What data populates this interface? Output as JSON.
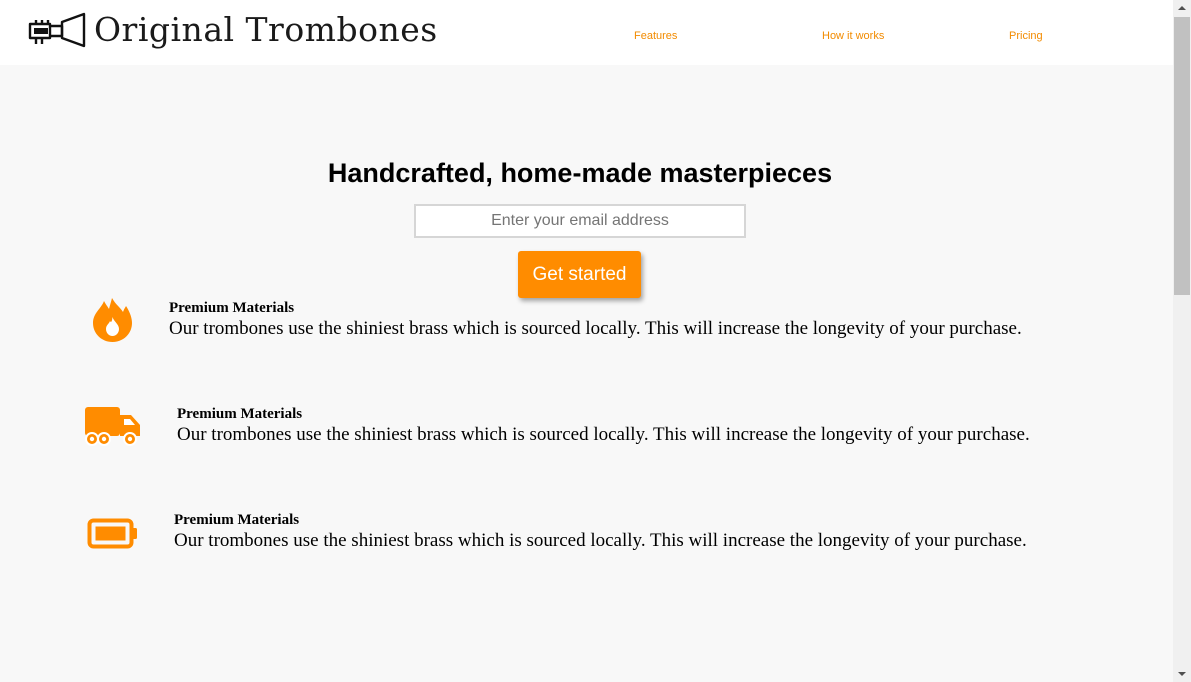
{
  "header": {
    "logo_icon": "trumpet-icon",
    "site_title": "Original Trombones",
    "nav": [
      {
        "label": "Features"
      },
      {
        "label": "How it works"
      },
      {
        "label": "Pricing"
      }
    ]
  },
  "hero": {
    "title": "Handcrafted, home-made masterpieces",
    "email_placeholder": "Enter your email address",
    "cta_label": "Get started"
  },
  "features": [
    {
      "icon": "fire-icon",
      "title": "Premium Materials",
      "description": "Our trombones use the shiniest brass which is sourced locally. This will increase the longevity of your purchase."
    },
    {
      "icon": "truck-icon",
      "title": "Premium Materials",
      "description": "Our trombones use the shiniest brass which is sourced locally. This will increase the longevity of your purchase."
    },
    {
      "icon": "battery-icon",
      "title": "Premium Materials",
      "description": "Our trombones use the shiniest brass which is sourced locally. This will increase the longevity of your purchase."
    }
  ],
  "colors": {
    "accent": "#ff8c00",
    "nav_link": "#f28b00",
    "page_background": "#f8f8f8",
    "header_background": "#ffffff"
  }
}
